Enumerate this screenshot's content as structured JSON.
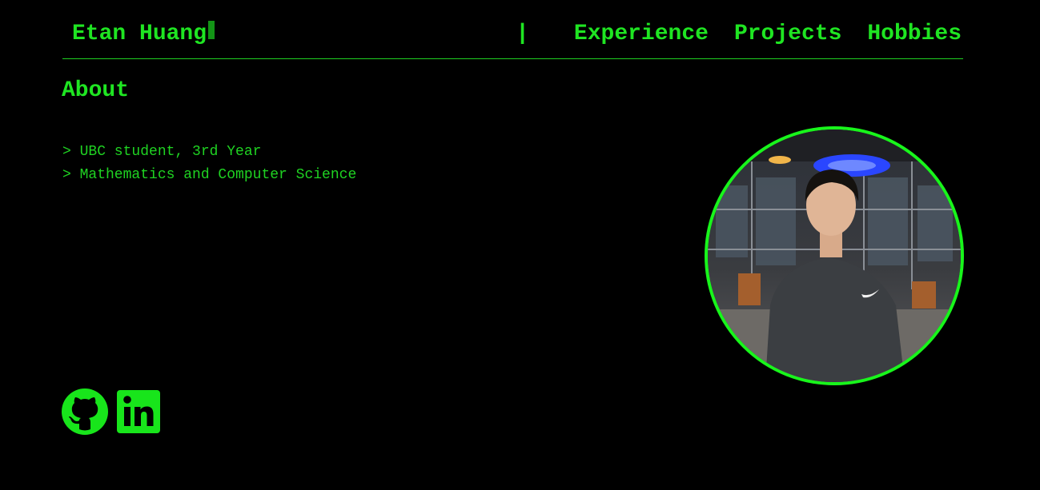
{
  "header": {
    "brand_name": "Etan Huang",
    "separator": "|",
    "nav": [
      {
        "label": "Experience"
      },
      {
        "label": "Projects"
      },
      {
        "label": "Hobbies"
      }
    ]
  },
  "about": {
    "title": "About",
    "items": [
      "> UBC student, 3rd Year",
      "> Mathematics and Computer Science"
    ]
  },
  "portrait": {
    "description": "circular profile photo"
  },
  "socials": [
    {
      "icon": "github-icon"
    },
    {
      "icon": "linkedin-icon"
    }
  ],
  "theme": {
    "background": "#000000",
    "accent": "#1fe522",
    "border": "#18f51b"
  }
}
